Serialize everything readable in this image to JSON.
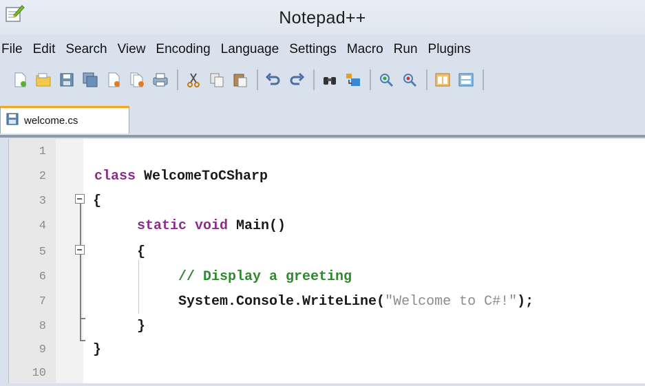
{
  "window": {
    "title": "Notepad++",
    "app_icon": "notepad-plus-plus-icon"
  },
  "menu": {
    "items": [
      "File",
      "Edit",
      "Search",
      "View",
      "Encoding",
      "Language",
      "Settings",
      "Macro",
      "Run",
      "Plugins"
    ]
  },
  "toolbar": {
    "buttons": [
      "new-file-icon",
      "open-file-icon",
      "save-icon",
      "save-all-icon",
      "close-icon",
      "close-all-icon",
      "print-icon",
      "cut-icon",
      "copy-icon",
      "paste-icon",
      "undo-icon",
      "redo-icon",
      "find-icon",
      "replace-icon",
      "zoom-in-icon",
      "zoom-out-icon",
      "sync-vertical-icon",
      "sync-horizontal-icon"
    ]
  },
  "tabs": [
    {
      "label": "welcome.cs",
      "icon": "saved-file-icon",
      "active": true,
      "accent": "#f5a623"
    }
  ],
  "editor": {
    "line_numbers": [
      "1",
      "2",
      "3",
      "4",
      "5",
      "6",
      "7",
      "8",
      "9",
      "10"
    ],
    "lines": {
      "l2_kw": "class",
      "l2_name": " WelcomeToCSharp",
      "l3": "{",
      "l4_kw": "static void",
      "l4_rest": " Main()",
      "l5": "{",
      "l6": "// Display a greeting",
      "l7_call": "System.Console.WriteLine(",
      "l7_str": "\"Welcome to C#!\"",
      "l7_end": ");",
      "l8": "}",
      "l9": "}"
    },
    "colors": {
      "keyword": "#8b2d8b",
      "comment": "#2f8a2f",
      "string": "#8c8c8c",
      "line_number": "#8a8a8a"
    }
  }
}
